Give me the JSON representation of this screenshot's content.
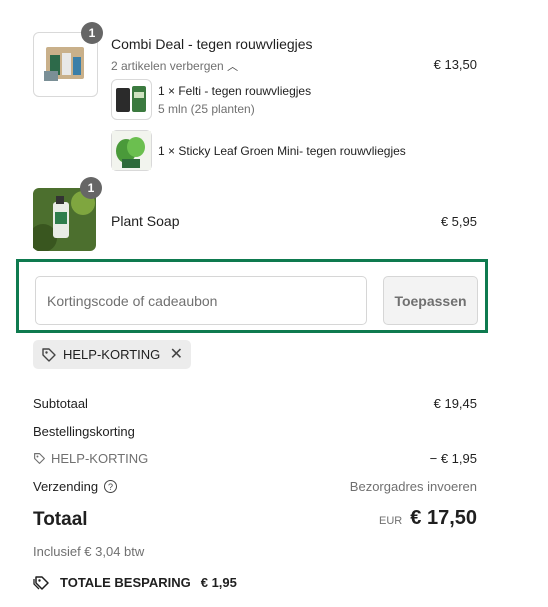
{
  "items": [
    {
      "title": "Combi Deal - tegen rouwvliegjes",
      "qty": "1",
      "toggle": "2 artikelen verbergen",
      "price": "€ 13,50",
      "subitems": [
        {
          "title": "1 × Felti - tegen rouwvliegjes",
          "subtitle": "5 mln (25 planten)"
        },
        {
          "title": "1 × Sticky Leaf Groen Mini- tegen rouwvliegjes"
        }
      ]
    },
    {
      "title": "Plant Soap",
      "qty": "1",
      "price": "€ 5,95"
    }
  ],
  "discount": {
    "placeholder": "Kortingscode of cadeaubon",
    "button": "Toepassen",
    "applied_code": "HELP-KORTING"
  },
  "summary": {
    "subtotal_label": "Subtotaal",
    "subtotal_value": "€ 19,45",
    "order_discount_label": "Bestellingskorting",
    "discount_code": "HELP-KORTING",
    "discount_value": "− € 1,95",
    "shipping_label": "Verzending",
    "shipping_value": "Bezorgadres invoeren",
    "total_label": "Totaal",
    "currency": "EUR",
    "total_value": "€ 17,50",
    "tax_note": "Inclusief € 3,04 btw",
    "savings_label": "TOTALE BESPARING",
    "savings_value": "€ 1,95"
  },
  "colors": {
    "accent": "#0e7a4f",
    "badge": "#666666"
  },
  "icons": [
    "tag-icon",
    "close-icon",
    "info-icon",
    "chevron-up-icon"
  ]
}
